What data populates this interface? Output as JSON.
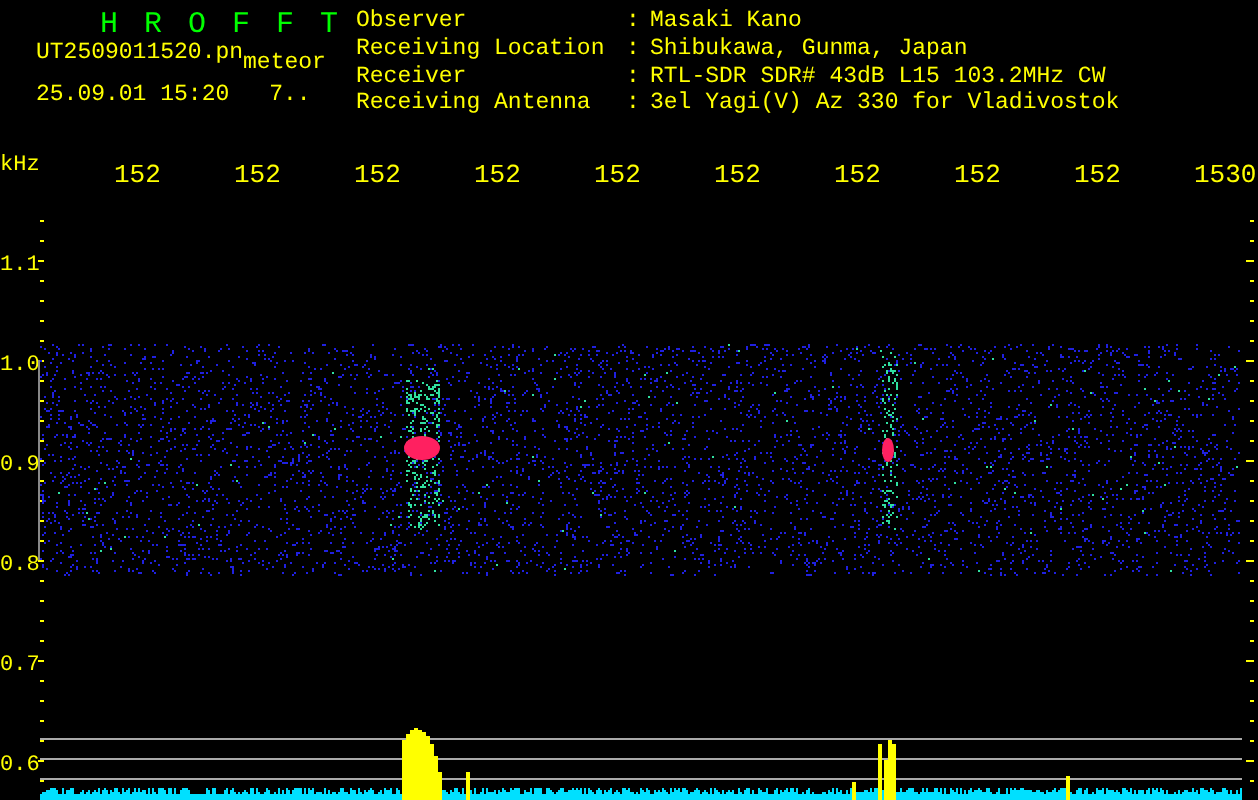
{
  "header": {
    "title": "H R O F F T",
    "file_name": "UT2509011520.pn",
    "tag": "meteor",
    "timestamp": "25.09.01 15:20",
    "count": "7..",
    "info": [
      {
        "label": "Observer",
        "separator": ":",
        "value": "Masaki Kano"
      },
      {
        "label": "Receiving Location",
        "separator": ":",
        "value": "Shibukawa, Gunma, Japan"
      },
      {
        "label": "Receiver",
        "separator": ":",
        "value": "RTL-SDR SDR# 43dB L15 103.2MHz CW"
      },
      {
        "label": "Receiving Antenna",
        "separator": ":",
        "value": "3el Yagi(V) Az 330 for Vladivostok"
      }
    ]
  },
  "spectrogram": {
    "unit": "kHz",
    "x_ticks": [
      "152",
      "152",
      "152",
      "152",
      "152",
      "152",
      "152",
      "152",
      "152",
      "1530"
    ],
    "y_ticks": [
      "1.1",
      "1.0",
      "0.9",
      "0.8",
      "0.7",
      "0.6"
    ]
  }
}
